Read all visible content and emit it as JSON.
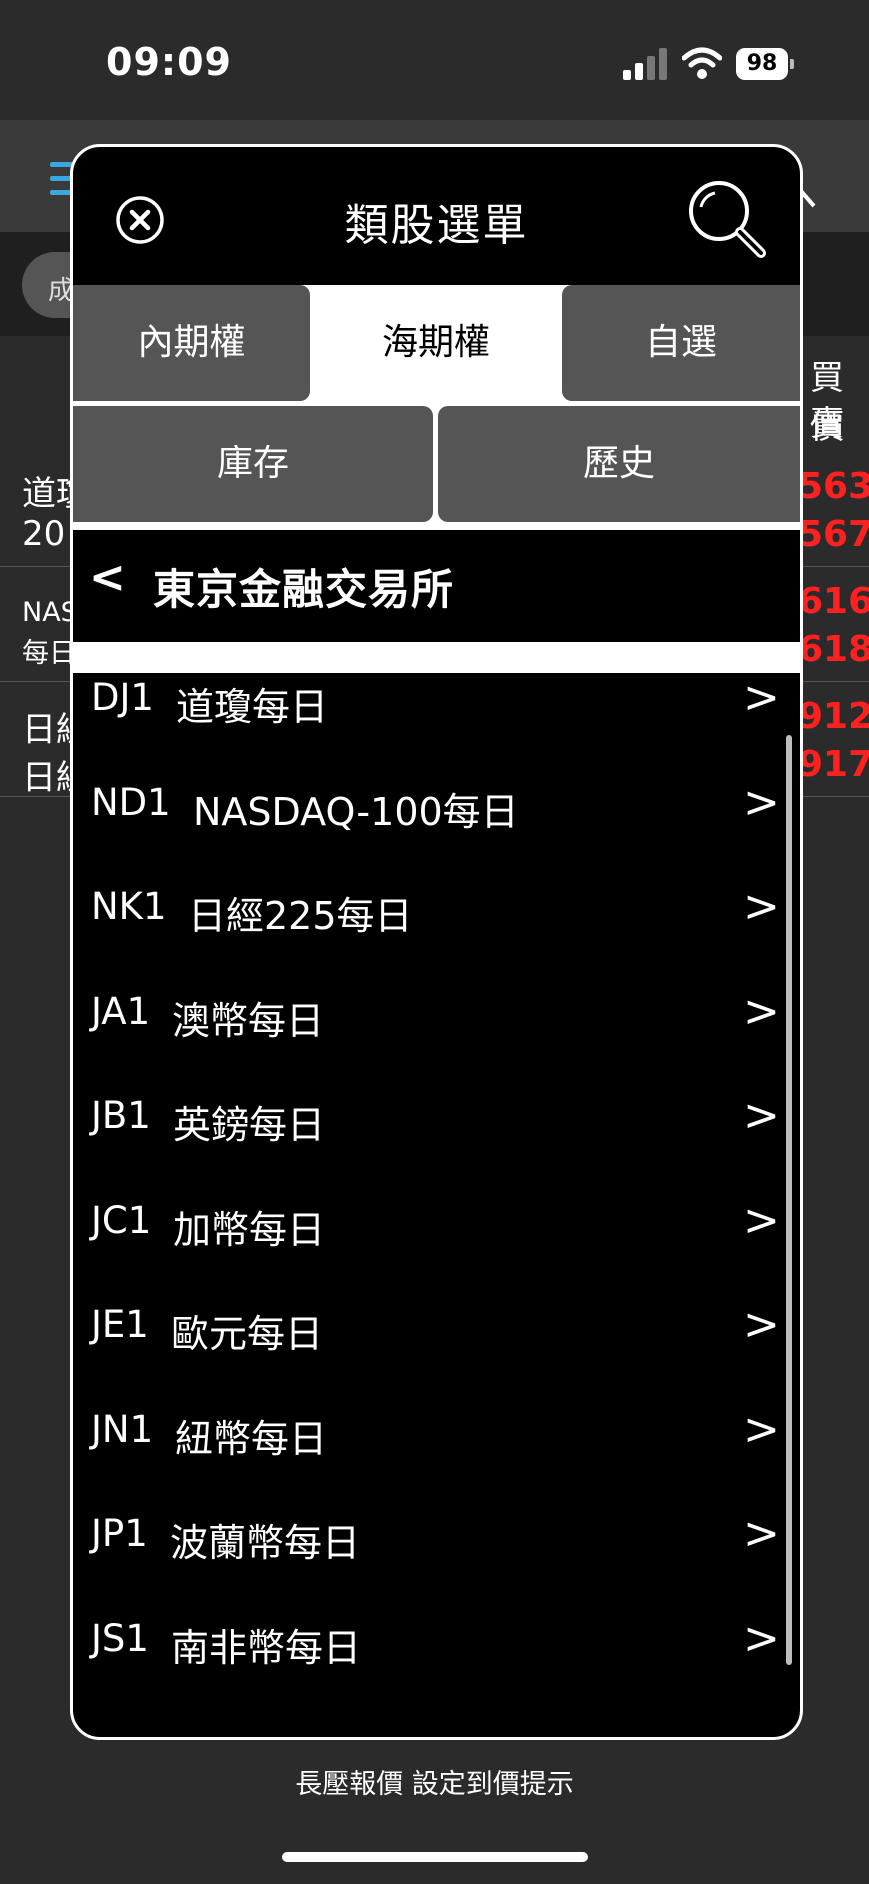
{
  "status_bar": {
    "time": "09:09",
    "battery": "98"
  },
  "background": {
    "filter_chip": "成",
    "col_header": [
      "買價",
      "賣價"
    ],
    "rows": [
      {
        "line1": "道瓊",
        "line2": "20",
        "price1": "563",
        "price2": "567",
        "small": false
      },
      {
        "line1": "NAS",
        "line2": "每日",
        "price1": "616",
        "price2": "618",
        "small": true
      },
      {
        "line1": "日經",
        "line2": "日經",
        "price1": "912",
        "price2": "917",
        "small": false
      }
    ]
  },
  "modal": {
    "title": "類股選單",
    "tabs": [
      {
        "label": "內期權",
        "active": false
      },
      {
        "label": "海期權",
        "active": true
      },
      {
        "label": "自選",
        "active": false
      },
      {
        "label": "庫存",
        "active": false
      },
      {
        "label": "歷史",
        "active": false
      }
    ],
    "breadcrumb": {
      "back": "<",
      "title": "東京金融交易所"
    },
    "items": [
      {
        "code": "DJ1",
        "label": "道瓊每日"
      },
      {
        "code": "ND1",
        "label": "NASDAQ-100每日"
      },
      {
        "code": "NK1",
        "label": "日經225每日"
      },
      {
        "code": "JA1",
        "label": "澳幣每日"
      },
      {
        "code": "JB1",
        "label": "英鎊每日"
      },
      {
        "code": "JC1",
        "label": "加幣每日"
      },
      {
        "code": "JE1",
        "label": "歐元每日"
      },
      {
        "code": "JN1",
        "label": "紐幣每日"
      },
      {
        "code": "JP1",
        "label": "波蘭幣每日"
      },
      {
        "code": "JS1",
        "label": "南非幣每日"
      }
    ],
    "chevron": ">"
  },
  "bottom_hint": "長壓報價 設定到價提示",
  "colors": {
    "price_red": "#ff2020",
    "menu_blue": "#3aa8e0",
    "tab_gray": "#555555"
  }
}
